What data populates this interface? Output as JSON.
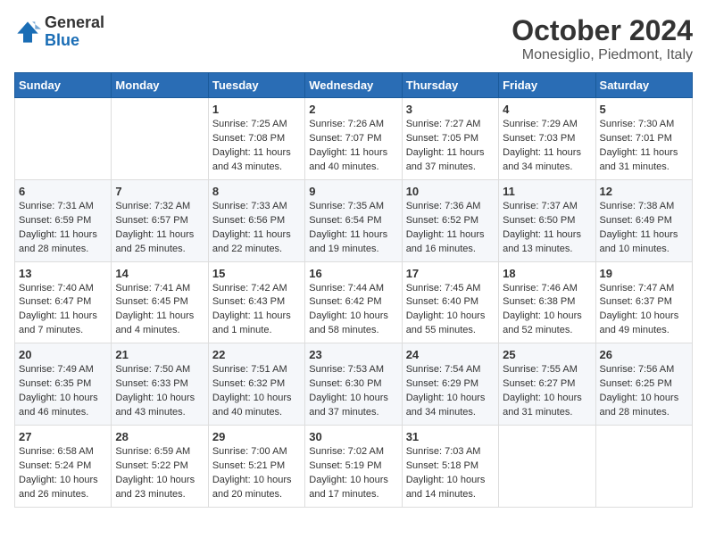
{
  "logo": {
    "text_general": "General",
    "text_blue": "Blue"
  },
  "header": {
    "month": "October 2024",
    "location": "Monesiglio, Piedmont, Italy"
  },
  "weekdays": [
    "Sunday",
    "Monday",
    "Tuesday",
    "Wednesday",
    "Thursday",
    "Friday",
    "Saturday"
  ],
  "weeks": [
    [
      {
        "day": "",
        "sunrise": "",
        "sunset": "",
        "daylight": ""
      },
      {
        "day": "",
        "sunrise": "",
        "sunset": "",
        "daylight": ""
      },
      {
        "day": "1",
        "sunrise": "Sunrise: 7:25 AM",
        "sunset": "Sunset: 7:08 PM",
        "daylight": "Daylight: 11 hours and 43 minutes."
      },
      {
        "day": "2",
        "sunrise": "Sunrise: 7:26 AM",
        "sunset": "Sunset: 7:07 PM",
        "daylight": "Daylight: 11 hours and 40 minutes."
      },
      {
        "day": "3",
        "sunrise": "Sunrise: 7:27 AM",
        "sunset": "Sunset: 7:05 PM",
        "daylight": "Daylight: 11 hours and 37 minutes."
      },
      {
        "day": "4",
        "sunrise": "Sunrise: 7:29 AM",
        "sunset": "Sunset: 7:03 PM",
        "daylight": "Daylight: 11 hours and 34 minutes."
      },
      {
        "day": "5",
        "sunrise": "Sunrise: 7:30 AM",
        "sunset": "Sunset: 7:01 PM",
        "daylight": "Daylight: 11 hours and 31 minutes."
      }
    ],
    [
      {
        "day": "6",
        "sunrise": "Sunrise: 7:31 AM",
        "sunset": "Sunset: 6:59 PM",
        "daylight": "Daylight: 11 hours and 28 minutes."
      },
      {
        "day": "7",
        "sunrise": "Sunrise: 7:32 AM",
        "sunset": "Sunset: 6:57 PM",
        "daylight": "Daylight: 11 hours and 25 minutes."
      },
      {
        "day": "8",
        "sunrise": "Sunrise: 7:33 AM",
        "sunset": "Sunset: 6:56 PM",
        "daylight": "Daylight: 11 hours and 22 minutes."
      },
      {
        "day": "9",
        "sunrise": "Sunrise: 7:35 AM",
        "sunset": "Sunset: 6:54 PM",
        "daylight": "Daylight: 11 hours and 19 minutes."
      },
      {
        "day": "10",
        "sunrise": "Sunrise: 7:36 AM",
        "sunset": "Sunset: 6:52 PM",
        "daylight": "Daylight: 11 hours and 16 minutes."
      },
      {
        "day": "11",
        "sunrise": "Sunrise: 7:37 AM",
        "sunset": "Sunset: 6:50 PM",
        "daylight": "Daylight: 11 hours and 13 minutes."
      },
      {
        "day": "12",
        "sunrise": "Sunrise: 7:38 AM",
        "sunset": "Sunset: 6:49 PM",
        "daylight": "Daylight: 11 hours and 10 minutes."
      }
    ],
    [
      {
        "day": "13",
        "sunrise": "Sunrise: 7:40 AM",
        "sunset": "Sunset: 6:47 PM",
        "daylight": "Daylight: 11 hours and 7 minutes."
      },
      {
        "day": "14",
        "sunrise": "Sunrise: 7:41 AM",
        "sunset": "Sunset: 6:45 PM",
        "daylight": "Daylight: 11 hours and 4 minutes."
      },
      {
        "day": "15",
        "sunrise": "Sunrise: 7:42 AM",
        "sunset": "Sunset: 6:43 PM",
        "daylight": "Daylight: 11 hours and 1 minute."
      },
      {
        "day": "16",
        "sunrise": "Sunrise: 7:44 AM",
        "sunset": "Sunset: 6:42 PM",
        "daylight": "Daylight: 10 hours and 58 minutes."
      },
      {
        "day": "17",
        "sunrise": "Sunrise: 7:45 AM",
        "sunset": "Sunset: 6:40 PM",
        "daylight": "Daylight: 10 hours and 55 minutes."
      },
      {
        "day": "18",
        "sunrise": "Sunrise: 7:46 AM",
        "sunset": "Sunset: 6:38 PM",
        "daylight": "Daylight: 10 hours and 52 minutes."
      },
      {
        "day": "19",
        "sunrise": "Sunrise: 7:47 AM",
        "sunset": "Sunset: 6:37 PM",
        "daylight": "Daylight: 10 hours and 49 minutes."
      }
    ],
    [
      {
        "day": "20",
        "sunrise": "Sunrise: 7:49 AM",
        "sunset": "Sunset: 6:35 PM",
        "daylight": "Daylight: 10 hours and 46 minutes."
      },
      {
        "day": "21",
        "sunrise": "Sunrise: 7:50 AM",
        "sunset": "Sunset: 6:33 PM",
        "daylight": "Daylight: 10 hours and 43 minutes."
      },
      {
        "day": "22",
        "sunrise": "Sunrise: 7:51 AM",
        "sunset": "Sunset: 6:32 PM",
        "daylight": "Daylight: 10 hours and 40 minutes."
      },
      {
        "day": "23",
        "sunrise": "Sunrise: 7:53 AM",
        "sunset": "Sunset: 6:30 PM",
        "daylight": "Daylight: 10 hours and 37 minutes."
      },
      {
        "day": "24",
        "sunrise": "Sunrise: 7:54 AM",
        "sunset": "Sunset: 6:29 PM",
        "daylight": "Daylight: 10 hours and 34 minutes."
      },
      {
        "day": "25",
        "sunrise": "Sunrise: 7:55 AM",
        "sunset": "Sunset: 6:27 PM",
        "daylight": "Daylight: 10 hours and 31 minutes."
      },
      {
        "day": "26",
        "sunrise": "Sunrise: 7:56 AM",
        "sunset": "Sunset: 6:25 PM",
        "daylight": "Daylight: 10 hours and 28 minutes."
      }
    ],
    [
      {
        "day": "27",
        "sunrise": "Sunrise: 6:58 AM",
        "sunset": "Sunset: 5:24 PM",
        "daylight": "Daylight: 10 hours and 26 minutes."
      },
      {
        "day": "28",
        "sunrise": "Sunrise: 6:59 AM",
        "sunset": "Sunset: 5:22 PM",
        "daylight": "Daylight: 10 hours and 23 minutes."
      },
      {
        "day": "29",
        "sunrise": "Sunrise: 7:00 AM",
        "sunset": "Sunset: 5:21 PM",
        "daylight": "Daylight: 10 hours and 20 minutes."
      },
      {
        "day": "30",
        "sunrise": "Sunrise: 7:02 AM",
        "sunset": "Sunset: 5:19 PM",
        "daylight": "Daylight: 10 hours and 17 minutes."
      },
      {
        "day": "31",
        "sunrise": "Sunrise: 7:03 AM",
        "sunset": "Sunset: 5:18 PM",
        "daylight": "Daylight: 10 hours and 14 minutes."
      },
      {
        "day": "",
        "sunrise": "",
        "sunset": "",
        "daylight": ""
      },
      {
        "day": "",
        "sunrise": "",
        "sunset": "",
        "daylight": ""
      }
    ]
  ]
}
